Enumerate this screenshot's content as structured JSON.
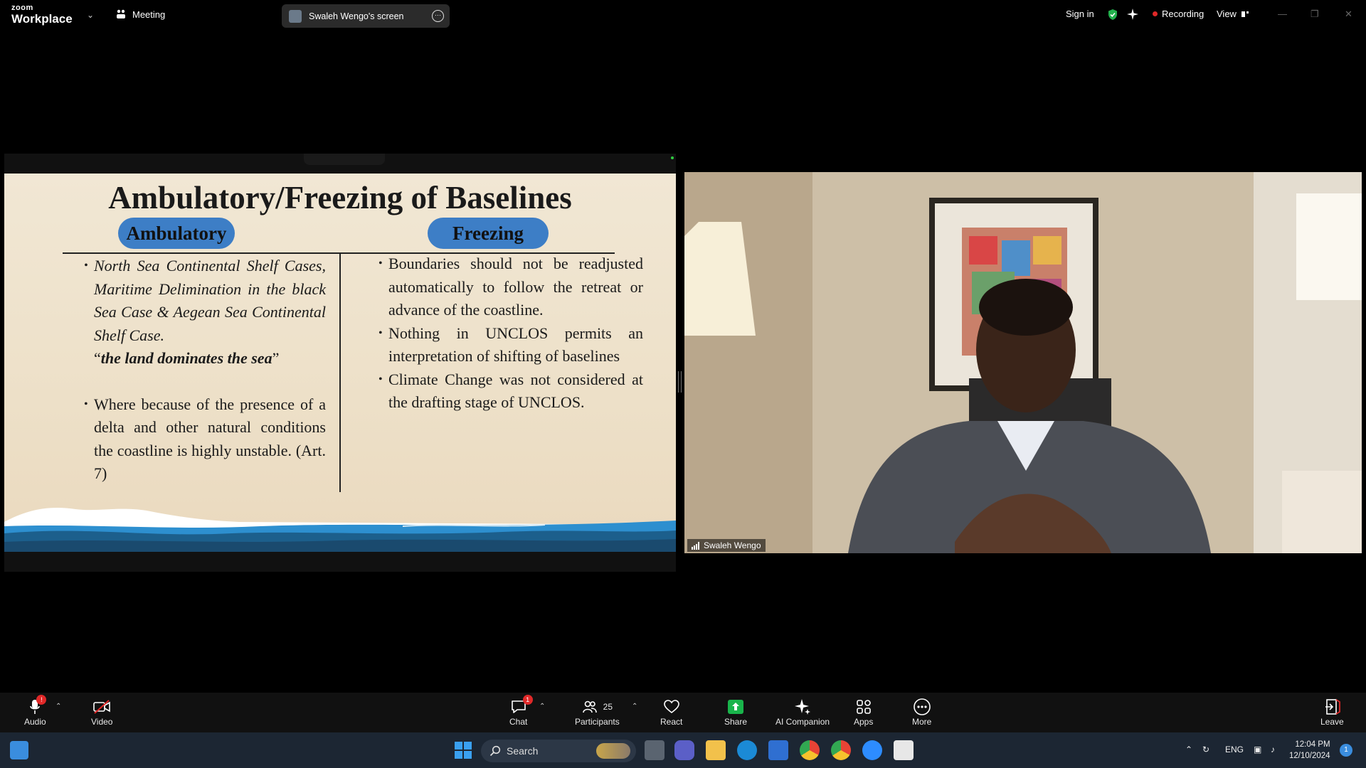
{
  "app": {
    "logo_top": "zoom",
    "logo_bottom": "Workplace",
    "meeting_label": "Meeting",
    "share_title": "Swaleh Wengo's screen",
    "sign_in": "Sign in",
    "recording": "Recording",
    "view": "View"
  },
  "slide": {
    "title": "Ambulatory/Freezing of Baselines",
    "left_heading": "Ambulatory",
    "right_heading": "Freezing",
    "left_items": [
      "North Sea Continental Shelf Cases, Maritime Delimination in the black Sea Case & Aegean Sea Continental Shelf Case.",
      "Where because of the presence of a delta and other natural conditions the coastline is highly unstable. (Art. 7)"
    ],
    "quote_open": "“",
    "quote": "the land dominates the sea",
    "quote_close": "”",
    "right_items": [
      "Boundaries should not be readjusted automatically to follow the retreat or advance of the coastline.",
      "Nothing in UNCLOS permits an interpretation of shifting of baselines",
      "Climate Change was not considered at the drafting stage of UNCLOS."
    ]
  },
  "video": {
    "participant_name": "Swaleh Wengo"
  },
  "toolbar": {
    "audio": "Audio",
    "video": "Video",
    "chat": "Chat",
    "chat_badge": "1",
    "audio_badge": "!",
    "participants": "Participants",
    "participants_count": "25",
    "react": "React",
    "share": "Share",
    "ai_companion": "AI Companion",
    "apps": "Apps",
    "more": "More",
    "leave": "Leave"
  },
  "taskbar": {
    "search_placeholder": "Search",
    "language": "ENG",
    "time": "12:04 PM",
    "date": "12/10/2024",
    "notification_count": "1"
  }
}
